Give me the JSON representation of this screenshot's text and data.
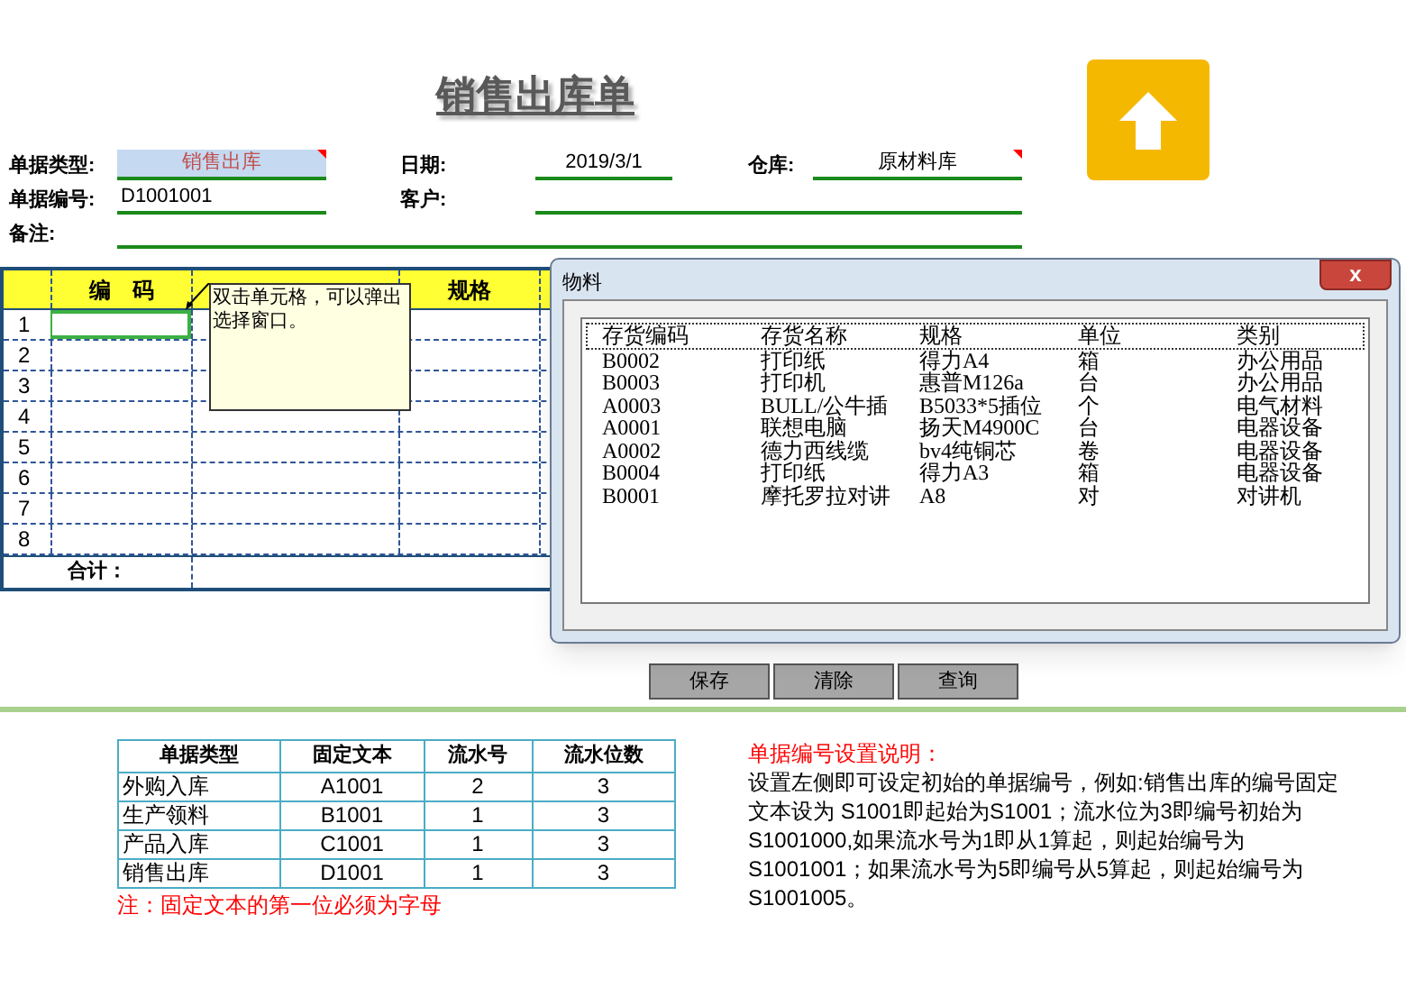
{
  "title": "销售出库单",
  "form": {
    "doc_type": {
      "label": "单据类型:",
      "value": "销售出库"
    },
    "date": {
      "label": "日期:",
      "value": "2019/3/1"
    },
    "warehouse": {
      "label": "仓库:",
      "value": "原材料库"
    },
    "doc_no": {
      "label": "单据编号:",
      "value": "D1001001"
    },
    "customer": {
      "label": "客户:"
    },
    "remark": {
      "label": "备注:"
    }
  },
  "grid": {
    "columns": [
      {
        "label": "编　码"
      },
      {},
      {
        "label": "规格"
      },
      {}
    ],
    "rows": [
      {
        "number": "1",
        "selected": true
      },
      {
        "number": "2",
        "selected": false
      },
      {
        "number": "3",
        "selected": false
      },
      {
        "number": "4",
        "selected": false
      },
      {
        "number": "5",
        "selected": false
      },
      {
        "number": "6",
        "selected": false
      },
      {
        "number": "7",
        "selected": false
      },
      {
        "number": "8",
        "selected": false
      }
    ],
    "total_label": "合计："
  },
  "comment": {
    "text": "双击单元格，可以弹出选择窗口。"
  },
  "buttons": [
    "保存",
    "清除",
    "查询"
  ],
  "dialog": {
    "title": "物料",
    "close": "x",
    "columns": [
      "存货编码",
      "存货名称",
      "规格",
      "单位",
      "类别"
    ],
    "rows": [
      [
        "B0002",
        "打印纸",
        "得力A4",
        "箱",
        "办公用品"
      ],
      [
        "B0003",
        "打印机",
        "惠普M126a",
        "台",
        "办公用品"
      ],
      [
        "A0003",
        "BULL/公牛插",
        "B5033*5插位",
        "个",
        "电气材料"
      ],
      [
        "A0001",
        "联想电脑",
        "扬天M4900C",
        "台",
        "电器设备"
      ],
      [
        "A0002",
        "德力西线缆",
        "bv4纯铜芯",
        "卷",
        "电器设备"
      ],
      [
        "B0004",
        "打印纸",
        "得力A3",
        "箱",
        "电器设备"
      ],
      [
        "B0001",
        "摩托罗拉对讲",
        "A8",
        "对",
        "对讲机"
      ]
    ]
  },
  "rule_table": {
    "columns": [
      "单据类型",
      "固定文本",
      "流水号",
      "流水位数"
    ],
    "rows": [
      [
        "外购入库",
        "A1001",
        "2",
        "3"
      ],
      [
        "生产领料",
        "B1001",
        "1",
        "3"
      ],
      [
        "产品入库",
        "C1001",
        "1",
        "3"
      ],
      [
        "销售出库",
        "D1001",
        "1",
        "3"
      ]
    ],
    "note": "注：固定文本的第一位必须为字母"
  },
  "explanation": {
    "title": "单据编号设置说明：",
    "text": "设置左侧即可设定初始的单据编号，例如:销售出库的编号固定文本设为 S1001即起始为S1001；流水位为3即编号初始为S1001000,如果流水号为1即从1算起，则起始编号为S1001001；如果流水号为5即编号从5算起，则起始编号为S1001005。"
  }
}
